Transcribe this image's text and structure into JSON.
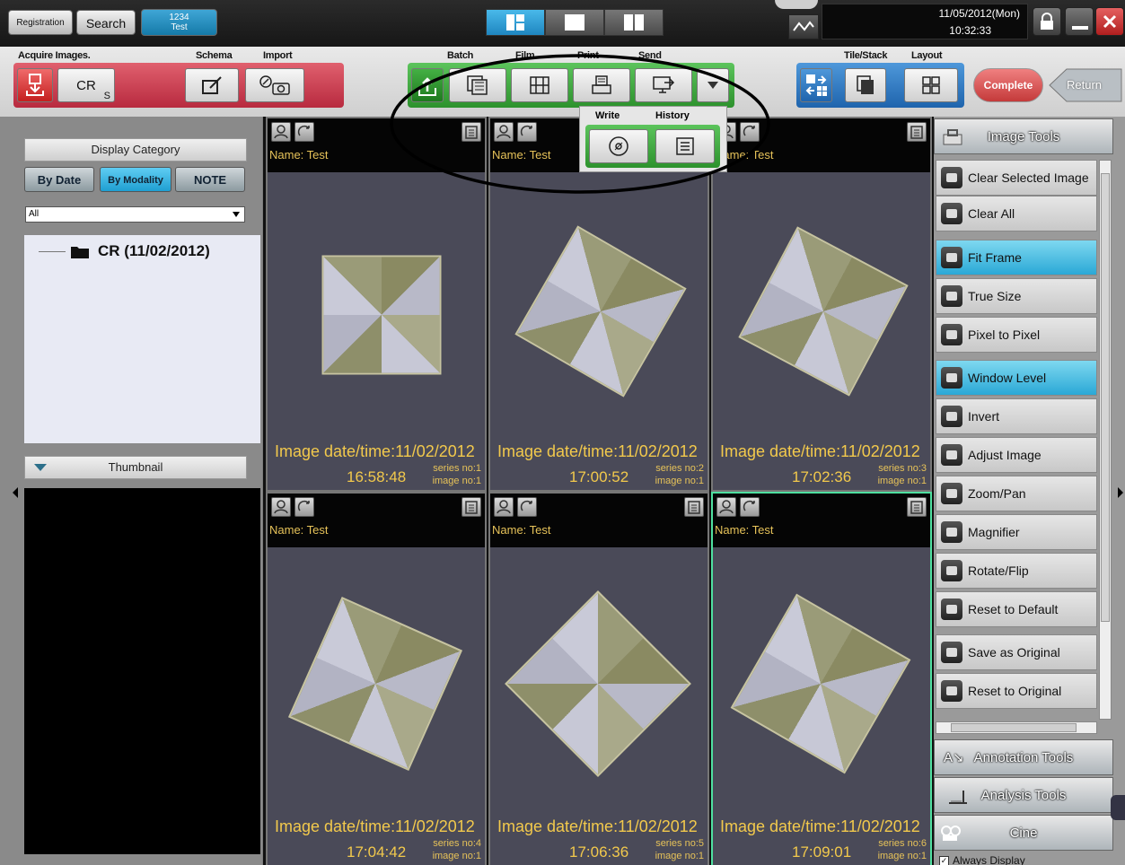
{
  "topbar": {
    "registration_label": "Registration",
    "search_label": "Search",
    "patient_id": "1234",
    "patient_name": "Test",
    "date": "11/05/2012(Mon)",
    "time": "10:32:33"
  },
  "toolbar": {
    "acquire_label": "Acquire Images.",
    "schema_label": "Schema",
    "import_label": "Import",
    "batch_label": "Batch",
    "film_label": "Film",
    "print_label": "Print",
    "send_label": "Send",
    "tilestack_label": "Tile/Stack",
    "layout_label": "Layout",
    "cr_label": "CR",
    "cr_sub": "S",
    "complete_label": "Complete",
    "return_label": "Return",
    "write_label": "Write",
    "history_label": "History"
  },
  "left": {
    "display_category": "Display Category",
    "by_date": "By Date",
    "by_modality": "By Modality",
    "note": "NOTE",
    "filter_value": "All",
    "tree_item": "CR (11/02/2012)",
    "thumbnail": "Thumbnail"
  },
  "viewers": [
    {
      "name": "Name: Test",
      "date": "Image date/time:11/02/2012",
      "time": "16:58:48",
      "series": "series no:1",
      "image": "image no:1"
    },
    {
      "name": "Name: Test",
      "date": "Image date/time:11/02/2012",
      "time": "17:00:52",
      "series": "series no:2",
      "image": "image no:1"
    },
    {
      "name": "Name: Test",
      "date": "Image date/time:11/02/2012",
      "time": "17:02:36",
      "series": "series no:3",
      "image": "image no:1"
    },
    {
      "name": "Name: Test",
      "date": "Image date/time:11/02/2012",
      "time": "17:04:42",
      "series": "series no:4",
      "image": "image no:1"
    },
    {
      "name": "Name: Test",
      "date": "Image date/time:11/02/2012",
      "time": "17:06:36",
      "series": "series no:5",
      "image": "image no:1"
    },
    {
      "name": "Name: Test",
      "date": "Image date/time:11/02/2012",
      "time": "17:09:01",
      "series": "series no:6",
      "image": "image no:1"
    }
  ],
  "right": {
    "image_tools": "Image Tools",
    "items": [
      "Clear Selected Image",
      "Clear All",
      "Fit Frame",
      "True Size",
      "Pixel to Pixel",
      "Window Level",
      "Invert",
      "Adjust Image",
      "Zoom/Pan",
      "Magnifier",
      "Rotate/Flip",
      "Reset to Default",
      "Save as Original",
      "Reset to Original"
    ],
    "annotation_tools": "Annotation Tools",
    "analysis_tools": "Analysis Tools",
    "cine": "Cine",
    "always_display": "Always Display"
  },
  "colors": {
    "accent": "#2aa8d6",
    "overlay_text": "#f2c94c",
    "acquire_group": "#c9404f",
    "batch_group": "#3aaa3a",
    "tile_group": "#2e7fc7"
  }
}
